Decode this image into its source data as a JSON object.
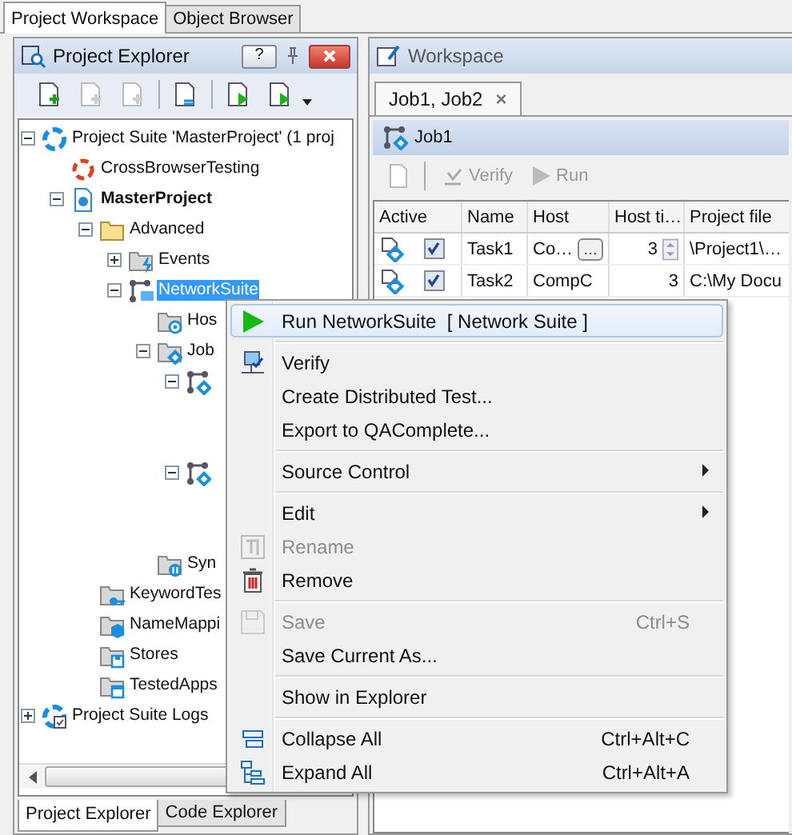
{
  "top_tabs": [
    {
      "label": "Project Workspace",
      "selected": true
    },
    {
      "label": "Object Browser",
      "selected": false
    }
  ],
  "explorer": {
    "title": "Project Explorer",
    "help": "?",
    "toolbar": [
      {
        "disabled": false
      },
      {
        "disabled": true
      },
      {
        "disabled": true
      },
      {
        "disabled": false
      },
      {
        "disabled": false
      },
      {
        "disabled": false
      }
    ],
    "tree": [
      {
        "kind": "suite",
        "label": "Project Suite 'MasterProject' (1 proj",
        "expanded": true,
        "selected": false,
        "children": [
          {
            "kind": "cbt",
            "label": "CrossBrowserTesting",
            "selected": false
          },
          {
            "kind": "project",
            "label": "MasterProject",
            "expanded": true,
            "selected": false,
            "children": [
              {
                "kind": "folder",
                "label": "Advanced",
                "expanded": true,
                "selected": false,
                "children": [
                  {
                    "kind": "events",
                    "label": "Events",
                    "expanded": false,
                    "selected": false
                  },
                  {
                    "kind": "network",
                    "label": "NetworkSuite",
                    "expanded": true,
                    "selected": true,
                    "children": [
                      {
                        "kind": "hosts",
                        "label": "Hos",
                        "selected": false
                      },
                      {
                        "kind": "jobs",
                        "label": "Job",
                        "expanded": true,
                        "selected": false,
                        "children": [
                          {
                            "kind": "job",
                            "expanded": true
                          },
                          {
                            "kind": "job",
                            "expanded": true
                          }
                        ]
                      },
                      {
                        "kind": "sync",
                        "label": "Syn",
                        "selected": false
                      }
                    ]
                  }
                ]
              },
              {
                "kind": "keyword",
                "label": "KeywordTes",
                "selected": false
              },
              {
                "kind": "namemap",
                "label": "NameMappi",
                "selected": false
              },
              {
                "kind": "stores",
                "label": "Stores",
                "selected": false
              },
              {
                "kind": "apps",
                "label": "TestedApps",
                "selected": false
              }
            ]
          }
        ]
      },
      {
        "kind": "logs",
        "label": "Project Suite Logs",
        "expanded": false,
        "selected": false
      }
    ],
    "bottom_tabs": [
      {
        "label": "Project Explorer",
        "selected": true
      },
      {
        "label": "Code Explorer",
        "selected": false
      }
    ]
  },
  "workspace": {
    "title": "Workspace",
    "doc_tabs": [
      {
        "label": "Job1, Job2",
        "close": "×",
        "selected": true
      }
    ],
    "job_title": "Job1",
    "toolbar": [
      {
        "label": "Verify",
        "disabled": true
      },
      {
        "label": "Run",
        "disabled": true
      }
    ],
    "columns": [
      "Active",
      "Name",
      "Host",
      "Host ti…",
      "Project file"
    ],
    "rows": [
      {
        "checked": true,
        "name": "Task1",
        "host": "Co…",
        "host_button": "…",
        "host_time": "3",
        "project_file": "\\Project1\\…"
      },
      {
        "checked": true,
        "name": "Task2",
        "host": "CompC",
        "host_time": "3",
        "project_file": "C:\\My Docu"
      }
    ]
  },
  "context_menu": [
    {
      "kind": "item",
      "label": "Run NetworkSuite  [ Network Suite ]",
      "selected": true,
      "disabled": false
    },
    {
      "kind": "separator"
    },
    {
      "kind": "item",
      "label": "Verify",
      "selected": false,
      "disabled": false
    },
    {
      "kind": "item",
      "label": "Create Distributed Test...",
      "selected": false,
      "disabled": false
    },
    {
      "kind": "item",
      "label": "Export to QAComplete...",
      "selected": false,
      "disabled": false
    },
    {
      "kind": "separator"
    },
    {
      "kind": "item",
      "label": "Source Control",
      "selected": false,
      "disabled": false,
      "submenu": true
    },
    {
      "kind": "separator"
    },
    {
      "kind": "item",
      "label": "Edit",
      "selected": false,
      "disabled": false,
      "submenu": true
    },
    {
      "kind": "item",
      "label": "Rename",
      "selected": false,
      "disabled": true
    },
    {
      "kind": "item",
      "label": "Remove",
      "selected": false,
      "disabled": false
    },
    {
      "kind": "separator"
    },
    {
      "kind": "item",
      "label": "Save",
      "selected": false,
      "disabled": true,
      "shortcut": "Ctrl+S"
    },
    {
      "kind": "item",
      "label": "Save Current As...",
      "selected": false,
      "disabled": false
    },
    {
      "kind": "separator"
    },
    {
      "kind": "item",
      "label": "Show in Explorer",
      "selected": false,
      "disabled": false
    },
    {
      "kind": "separator"
    },
    {
      "kind": "item",
      "label": "Collapse All",
      "selected": false,
      "disabled": false,
      "shortcut": "Ctrl+Alt+C"
    },
    {
      "kind": "item",
      "label": "Expand All",
      "selected": false,
      "disabled": false,
      "shortcut": "Ctrl+Alt+A"
    }
  ]
}
